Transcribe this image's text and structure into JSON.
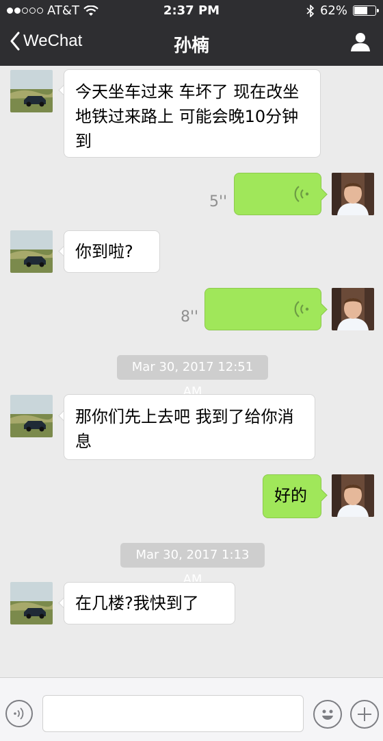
{
  "status_bar": {
    "carrier": "AT&T",
    "time": "2:37 PM",
    "battery": "62%",
    "battery_level": 0.62
  },
  "nav": {
    "back_label": "WeChat",
    "title": "孙楠"
  },
  "messages": [
    {
      "side": "in",
      "text": "今天坐车过来 车坏了 现在改坐地铁过来路上 可能会晚10分钟到"
    },
    {
      "side": "out",
      "voice_duration": "5''"
    },
    {
      "side": "in",
      "text": "你到啦?"
    },
    {
      "side": "out",
      "voice_duration": "8''"
    },
    {
      "timestamp": "Mar 30, 2017 12:51 AM"
    },
    {
      "side": "in",
      "text": "那你们先上去吧 我到了给你消息"
    },
    {
      "side": "out",
      "text": "好的"
    },
    {
      "timestamp": "Mar 30, 2017 1:13 AM"
    },
    {
      "side": "in",
      "text": "在几楼?我快到了"
    }
  ],
  "icons": {
    "back": "chevron-left-icon",
    "profile": "person-icon",
    "voice": "voice-wave-icon",
    "emoji": "smiley-icon",
    "plus": "plus-icon"
  },
  "colors": {
    "nav_bg": "#2e2e31",
    "chat_bg": "#ebebeb",
    "outgoing": "#a0e75a",
    "incoming": "#ffffff"
  }
}
